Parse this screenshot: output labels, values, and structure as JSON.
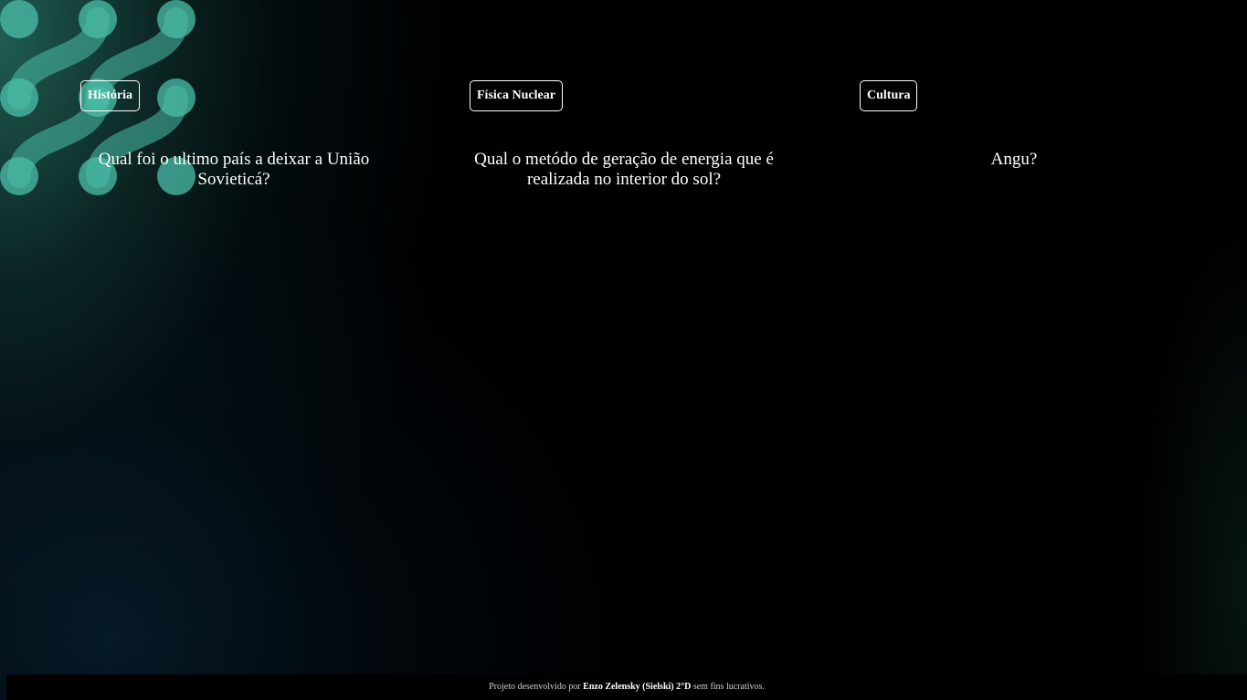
{
  "cards": [
    {
      "category": "História",
      "question": "Qual foi o ultimo país a deixar a União Sovieticá?"
    },
    {
      "category": "Física Nuclear",
      "question": "Qual o metódo de geração de energia que é realizada no interior do sol?"
    },
    {
      "category": "Cultura",
      "question": "Angu?"
    }
  ],
  "footer": {
    "prefix": "Projeto desenvolvido por",
    "author": "Enzo Zelensky (Sielski) 2°D",
    "suffix": "sem fins lucrativos."
  },
  "colors": {
    "background": "#000000",
    "accent_teal": "#4ec3b0",
    "text": "#ffffff"
  },
  "decoration": {
    "icon": "teal-molecule-pattern"
  }
}
